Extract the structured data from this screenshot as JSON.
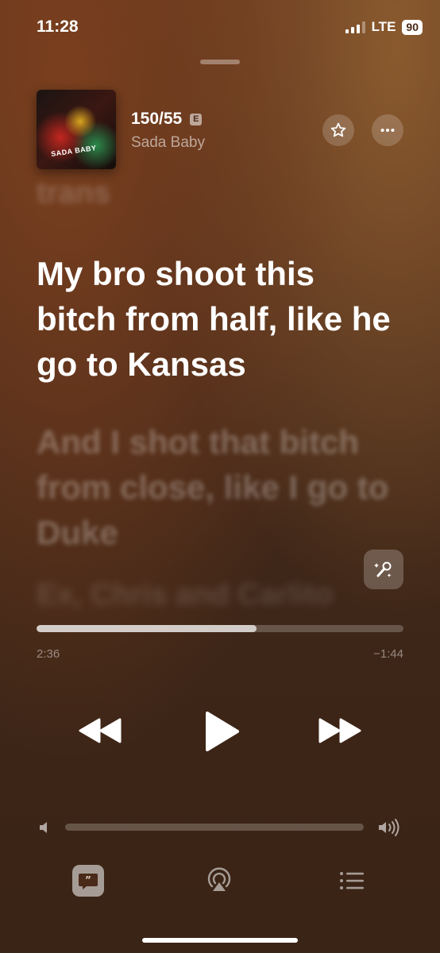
{
  "status_bar": {
    "time": "11:28",
    "network": "LTE",
    "battery": "90"
  },
  "now_playing": {
    "title": "150/55",
    "explicit_badge": "E",
    "artist": "Sada Baby",
    "artwork_text": "SADA BABY"
  },
  "lyrics": {
    "previous": "trans",
    "current": "My bro shoot this bitch from half, like he go to Kansas",
    "next": "And I shot that bitch from close, like I go to Duke",
    "after": "Ex, Chris and Carlito"
  },
  "playback": {
    "elapsed": "2:36",
    "remaining": "−1:44",
    "progress": 0.6
  },
  "volume": {
    "level": 0
  },
  "icons": {
    "favorite": "star-icon",
    "more": "ellipsis-icon",
    "sing": "microphone-sparkle-icon",
    "rewind": "rewind-icon",
    "play": "play-icon",
    "forward": "fast-forward-icon",
    "volume_low": "speaker-low-icon",
    "volume_high": "speaker-high-icon",
    "lyrics": "lyrics-quote-icon",
    "airplay": "airplay-icon",
    "queue": "list-icon"
  }
}
